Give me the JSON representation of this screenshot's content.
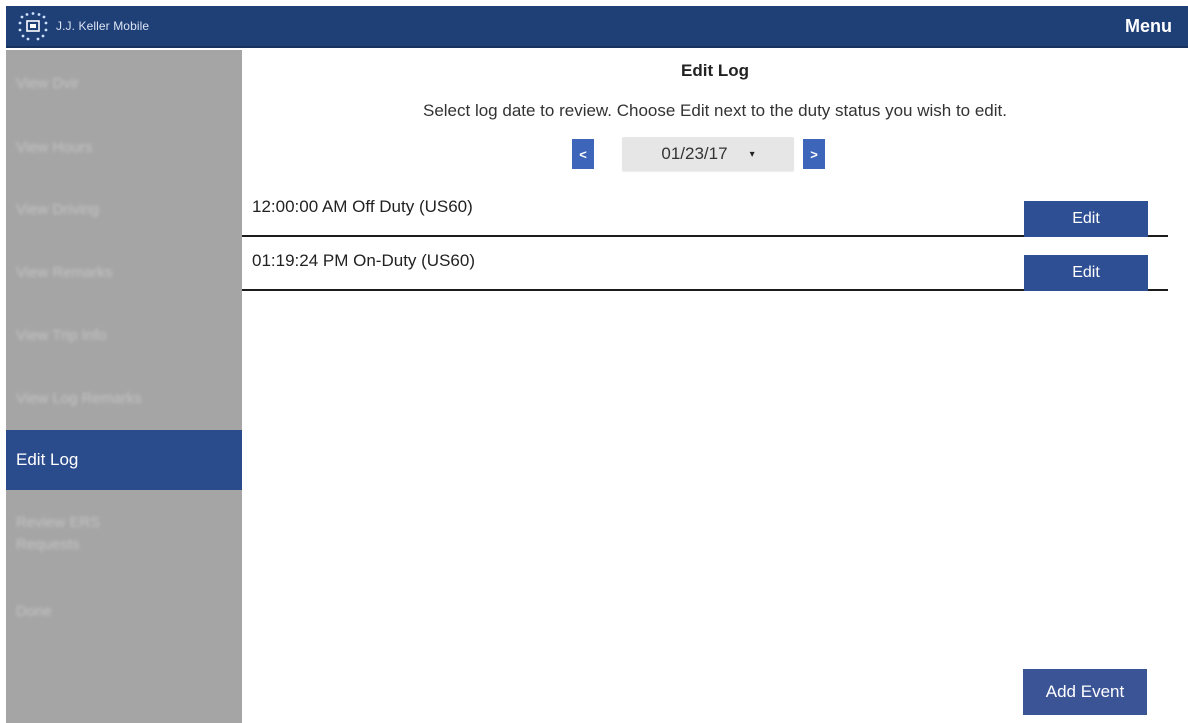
{
  "header": {
    "app_title": "J.J. Keller Mobile",
    "menu_label": "Menu",
    "logo_icon": "jj-keller-logo-icon"
  },
  "sidebar": {
    "items": [
      {
        "label": "View Dvir"
      },
      {
        "label": "View Hours"
      },
      {
        "label": "View Driving"
      },
      {
        "label": "View Remarks"
      },
      {
        "label": "View Trip Info"
      },
      {
        "label": "View Log Remarks"
      },
      {
        "label": "Edit Log",
        "active": true
      },
      {
        "label": "Review ERS Requests"
      },
      {
        "label": "Done"
      }
    ]
  },
  "main": {
    "title": "Edit Log",
    "instructions": "Select log date to review. Choose Edit next to the duty status you wish to edit.",
    "date_nav": {
      "prev_label": "<",
      "next_label": ">",
      "selected_date": "01/23/17",
      "caret": "▾"
    },
    "log_entries": [
      {
        "text": "12:00:00 AM Off Duty (US60)",
        "action": "Edit"
      },
      {
        "text": "01:19:24 PM On-Duty (US60)",
        "action": "Edit"
      }
    ],
    "add_event_label": "Add Event"
  },
  "colors": {
    "header_bg": "#1f3f77",
    "sidebar_bg": "#a5a5a5",
    "active_nav_bg": "#2b4c8c",
    "button_bg": "#2f4f94",
    "arrow_bg": "#3d65b9"
  }
}
